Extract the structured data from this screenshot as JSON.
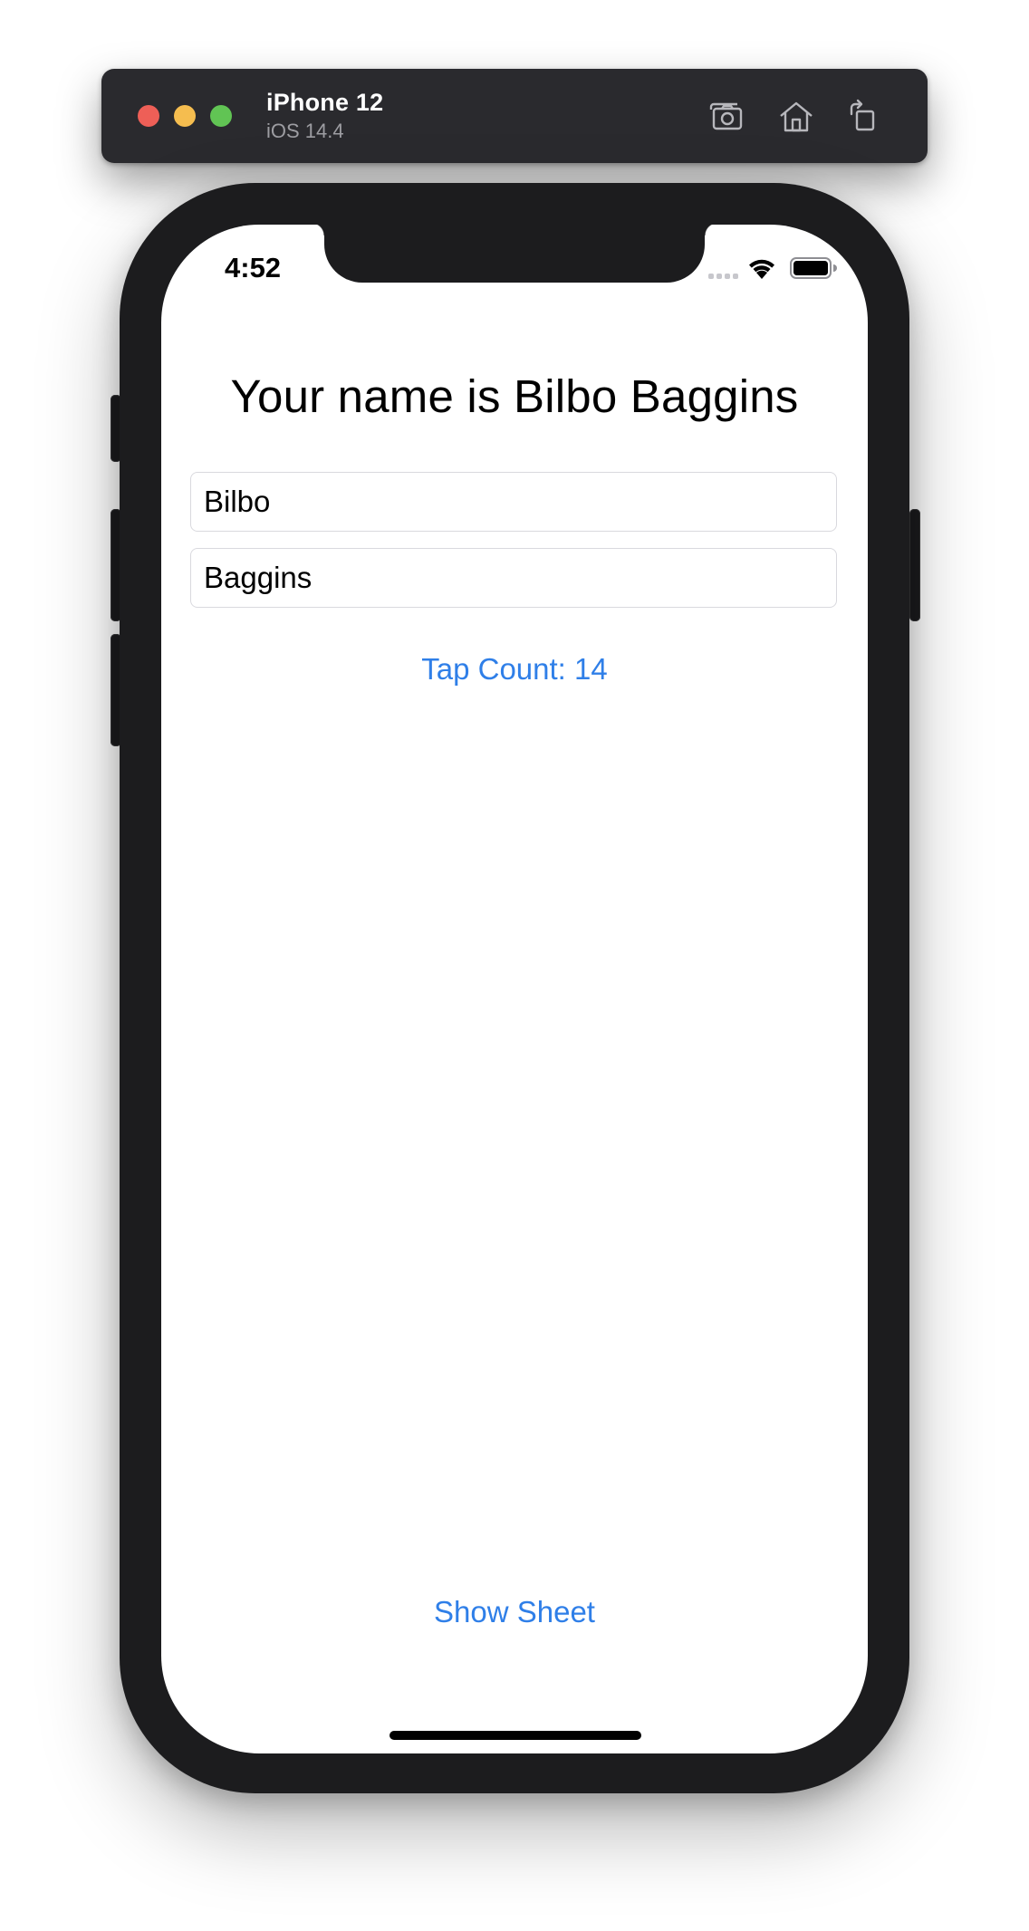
{
  "simulator": {
    "device_name": "iPhone 12",
    "os_version": "iOS 14.4",
    "toolbar_icons": [
      "screenshot-icon",
      "home-icon",
      "rotate-icon"
    ],
    "traffic_light_colors": {
      "close": "#ee5f57",
      "minimize": "#f5bd4f",
      "zoom": "#61c454"
    }
  },
  "status_bar": {
    "time": "4:52",
    "icons": [
      "cellular-signal-icon",
      "wifi-icon",
      "battery-icon"
    ]
  },
  "app": {
    "headline": "Your name is Bilbo Baggins",
    "first_name_value": "Bilbo",
    "last_name_value": "Baggins",
    "tap_count_label": "Tap Count: 14",
    "show_sheet_label": "Show Sheet",
    "accent_color": "#2f7fe8"
  }
}
